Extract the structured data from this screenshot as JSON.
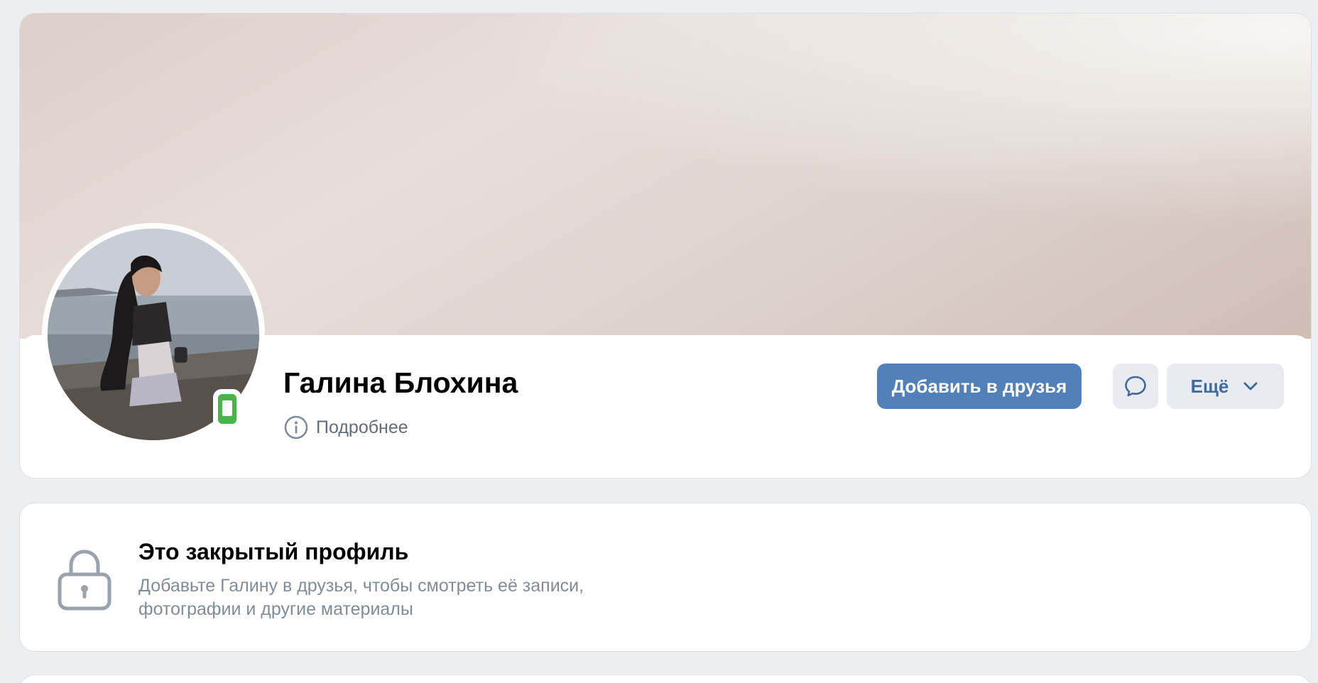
{
  "profile": {
    "name": "Галина Блохина",
    "details_label": "Подробнее",
    "online_status_icon": "mobile-online-icon"
  },
  "actions": {
    "add_friend_label": "Добавить в друзья",
    "message_icon": "message-bubble-icon",
    "more_label": "Ещё",
    "more_icon": "chevron-down-icon"
  },
  "private_notice": {
    "title": "Это закрытый профиль",
    "text": "Добавьте Галину в друзья, чтобы смотреть её записи, фотографии и другие материалы",
    "icon": "lock-icon"
  },
  "colors": {
    "page_bg": "#edeef0",
    "primary_button": "#5181b8",
    "secondary_button": "#e8ecf1",
    "secondary_text": "#3f6a9c",
    "muted_text": "#818c99",
    "online_green": "#4bb34b"
  }
}
